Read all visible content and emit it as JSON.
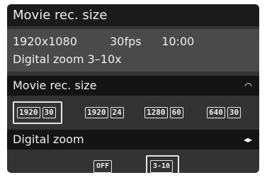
{
  "title": "Movie rec. size",
  "info": {
    "resolution": "1920x1080",
    "fps": "30fps",
    "time": "10:00",
    "digital_zoom": "Digital zoom 3–10x"
  },
  "movie_rec_size": {
    "label": "Movie rec. size",
    "indicator": "◠",
    "options": [
      {
        "size": "1920",
        "rate": "30"
      },
      {
        "size": "1920",
        "rate": "24"
      },
      {
        "size": "1280",
        "rate": "60"
      },
      {
        "size": "640",
        "rate": "30"
      }
    ]
  },
  "digital_zoom": {
    "label": "Digital zoom",
    "indicator": "◂▸",
    "options": [
      {
        "label": "OFF"
      },
      {
        "label": "3-10"
      }
    ]
  }
}
